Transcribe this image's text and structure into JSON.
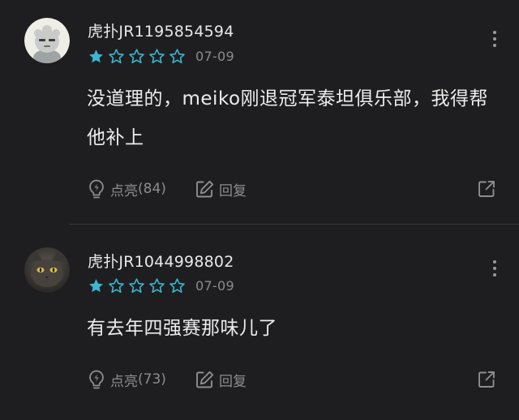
{
  "comments": [
    {
      "username": "虎扑JR1195854594",
      "rating": 1,
      "max_rating": 5,
      "date": "07-09",
      "content": "没道理的，meiko刚退冠军泰坦俱乐部，我得帮他补上",
      "light_label": "点亮",
      "light_count": "(84)",
      "reply_label": "回复",
      "avatar_icon": "cartoon-avatar"
    },
    {
      "username": "虎扑JR1044998802",
      "rating": 1,
      "max_rating": 5,
      "date": "07-09",
      "content": "有去年四强赛那味儿了",
      "light_label": "点亮",
      "light_count": "(73)",
      "reply_label": "回复",
      "avatar_icon": "cat-avatar"
    }
  ],
  "colors": {
    "background": "#1e1e20",
    "star": "#3cb7cf",
    "muted": "#8d8d90",
    "divider": "#38383b"
  },
  "icons": {
    "more": "more-vertical-icon",
    "light": "lightbulb-icon",
    "reply": "edit-icon",
    "share": "share-icon"
  }
}
